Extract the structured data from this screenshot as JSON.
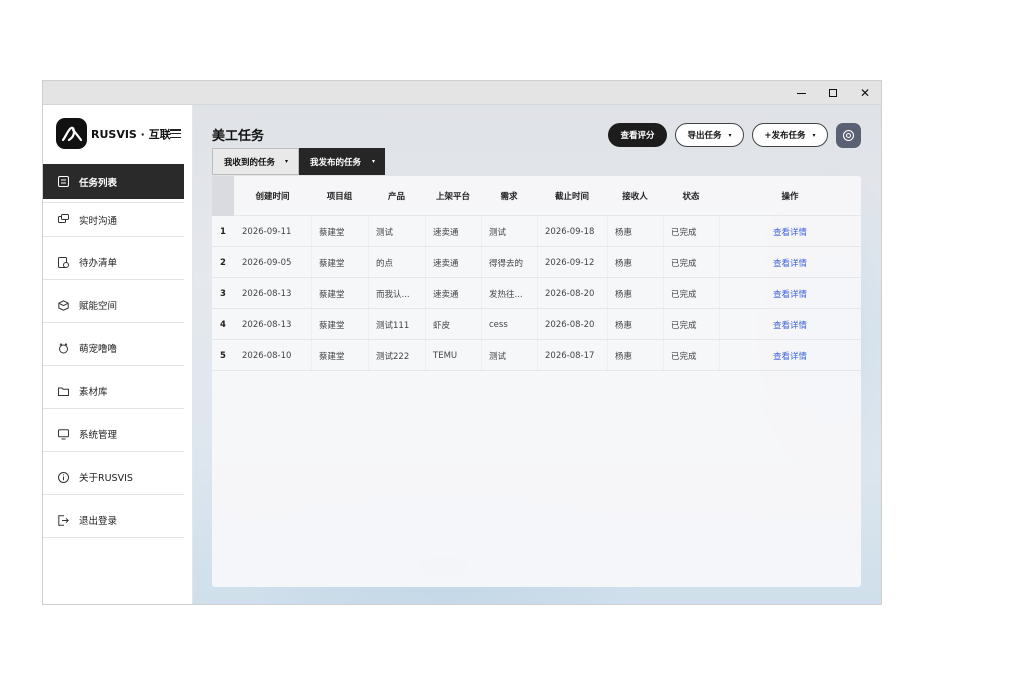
{
  "window": {
    "controls": {
      "minimize": "—",
      "maximize": "□",
      "close": "✕"
    }
  },
  "sidebar": {
    "brand": "RUSVIS · 互联",
    "logo_icon": "rusvis-logo-icon",
    "items": [
      {
        "label": "任务列表",
        "icon": "list-icon",
        "active": true
      },
      {
        "label": "实时沟通",
        "icon": "chat-icon"
      },
      {
        "label": "待办清单",
        "icon": "todo-icon"
      },
      {
        "label": "赋能空间",
        "icon": "box-icon"
      },
      {
        "label": "萌宠噜噜",
        "icon": "pet-icon"
      },
      {
        "label": "素材库",
        "icon": "folder-icon"
      },
      {
        "label": "系统管理",
        "icon": "monitor-icon"
      },
      {
        "label": "关于RUSVIS",
        "icon": "info-icon"
      },
      {
        "label": "退出登录",
        "icon": "logout-icon"
      }
    ]
  },
  "main": {
    "title": "美工任务",
    "tabs": [
      {
        "label": "我收到的任务",
        "caret": "▾"
      },
      {
        "label": "我发布的任务",
        "caret": "▾"
      }
    ],
    "actions": {
      "score": "查看评分",
      "export": "导出任务",
      "export_caret": "▾",
      "publish": "+发布任务",
      "publish_caret": "▾",
      "settings_icon": "settings-icon"
    },
    "table": {
      "columns": [
        "创建时间",
        "项目组",
        "产品",
        "上架平台",
        "需求",
        "截止时间",
        "接收人",
        "状态",
        "操作"
      ],
      "rows": [
        {
          "no": "1",
          "created": "2026-09-11",
          "group": "蔡建堂",
          "product": "测试",
          "platform": "速卖通",
          "demand": "测试",
          "deadline": "2026-09-18",
          "receiver": "杨惠",
          "status": "已完成",
          "action": "查看详情"
        },
        {
          "no": "2",
          "created": "2026-09-05",
          "group": "蔡建堂",
          "product": "的点",
          "platform": "速卖通",
          "demand": "得得去的",
          "deadline": "2026-09-12",
          "receiver": "杨惠",
          "status": "已完成",
          "action": "查看详情"
        },
        {
          "no": "3",
          "created": "2026-08-13",
          "group": "蔡建堂",
          "product": "而我认...",
          "platform": "速卖通",
          "demand": "发热往...",
          "deadline": "2026-08-20",
          "receiver": "杨惠",
          "status": "已完成",
          "action": "查看详情"
        },
        {
          "no": "4",
          "created": "2026-08-13",
          "group": "蔡建堂",
          "product": "测试111",
          "platform": "虾皮",
          "demand": "cess",
          "deadline": "2026-08-20",
          "receiver": "杨惠",
          "status": "已完成",
          "action": "查看详情"
        },
        {
          "no": "5",
          "created": "2026-08-10",
          "group": "蔡建堂",
          "product": "测试222",
          "platform": "TEMU",
          "demand": "测试",
          "deadline": "2026-08-17",
          "receiver": "杨惠",
          "status": "已完成",
          "action": "查看详情"
        }
      ]
    }
  }
}
